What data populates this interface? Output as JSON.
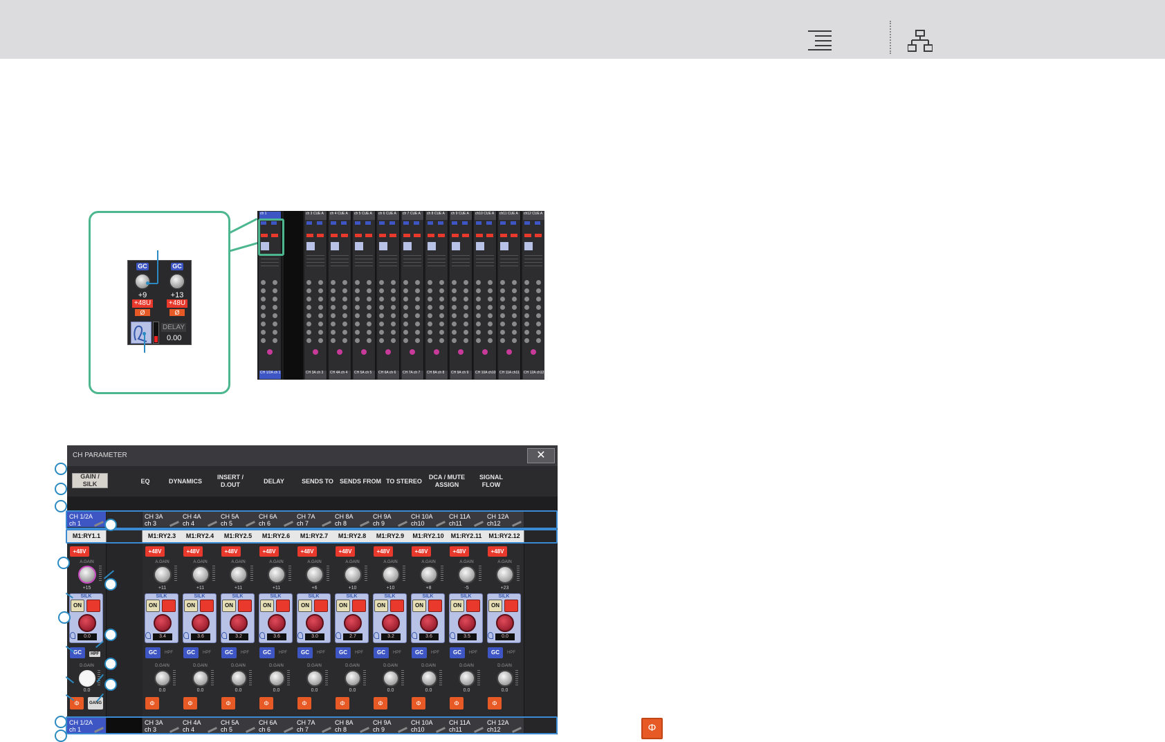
{
  "topbar": {
    "menu_icon": "menu-icon",
    "tree_icon": "hierarchy-icon"
  },
  "zoom": {
    "gc": "GC",
    "left_gain": "+9",
    "right_gain": "+13",
    "p48": "+48U",
    "phase": "Ø",
    "delay_label": "DELAY",
    "delay_value": "0.00"
  },
  "overview": {
    "channels": [
      {
        "h1": "ch 1",
        "h2": "",
        "f1": "CH 1/2A",
        "f2": "ch 1"
      },
      {
        "h1": "ch 3",
        "h2": "CUE A",
        "f1": "CH 3A",
        "f2": "ch 3"
      },
      {
        "h1": "ch 4",
        "h2": "CUE A",
        "f1": "CH 4A",
        "f2": "ch 4"
      },
      {
        "h1": "ch 5",
        "h2": "CUE A",
        "f1": "CH 5A",
        "f2": "ch 5"
      },
      {
        "h1": "ch 6",
        "h2": "CUE A",
        "f1": "CH 6A",
        "f2": "ch 6"
      },
      {
        "h1": "ch 7",
        "h2": "CUE A",
        "f1": "CH 7A",
        "f2": "ch 7"
      },
      {
        "h1": "ch 8",
        "h2": "CUE A",
        "f1": "CH 8A",
        "f2": "ch 8"
      },
      {
        "h1": "ch 9",
        "h2": "CUE A",
        "f1": "CH 9A",
        "f2": "ch 9"
      },
      {
        "h1": "ch10",
        "h2": "CUE A",
        "f1": "CH 10A",
        "f2": "ch10"
      },
      {
        "h1": "ch11",
        "h2": "CUE A",
        "f1": "CH 11A",
        "f2": "ch11"
      },
      {
        "h1": "ch12",
        "h2": "CUE A",
        "f1": "CH 12A",
        "f2": "ch12"
      }
    ]
  },
  "window": {
    "title": "CH PARAMETER",
    "close": "✕",
    "tabs": [
      {
        "label": "GAIN / SILK"
      },
      {
        "label": "EQ"
      },
      {
        "label": "DYNAMICS"
      },
      {
        "label": "INSERT / D.OUT"
      },
      {
        "label": "DELAY"
      },
      {
        "label": "SENDS TO"
      },
      {
        "label": "SENDS FROM"
      },
      {
        "label": "TO STEREO"
      },
      {
        "label": "DCA / MUTE ASSIGN"
      },
      {
        "label": "SIGNAL FLOW"
      }
    ],
    "labels": {
      "p48": "+48V",
      "again": "A.GAIN",
      "silk": "SILK",
      "on": "ON",
      "gc": "GC",
      "hpf": "HPF",
      "dgain": "D.GAIN",
      "phase": "Φ",
      "gang": "GANG"
    },
    "strips": [
      {
        "name1": "CH 1/2A",
        "name2": "ch 1",
        "patch": "M1:RY1.1",
        "again": "+15",
        "silk": "0.0",
        "dgain": "0.0"
      },
      {
        "name1": "CH 3A",
        "name2": "ch 3",
        "patch": "M1:RY2.3",
        "again": "+11",
        "silk": "3.4",
        "dgain": "0.0"
      },
      {
        "name1": "CH 4A",
        "name2": "ch 4",
        "patch": "M1:RY2.4",
        "again": "+11",
        "silk": "3.6",
        "dgain": "0.0"
      },
      {
        "name1": "CH 5A",
        "name2": "ch 5",
        "patch": "M1:RY2.5",
        "again": "+11",
        "silk": "3.2",
        "dgain": "0.0"
      },
      {
        "name1": "CH 6A",
        "name2": "ch 6",
        "patch": "M1:RY2.6",
        "again": "+11",
        "silk": "3.6",
        "dgain": "0.0"
      },
      {
        "name1": "CH 7A",
        "name2": "ch 7",
        "patch": "M1:RY2.7",
        "again": "+6",
        "silk": "3.0",
        "dgain": "0.0"
      },
      {
        "name1": "CH 8A",
        "name2": "ch 8",
        "patch": "M1:RY2.8",
        "again": "+10",
        "silk": "2.7",
        "dgain": "0.0"
      },
      {
        "name1": "CH 9A",
        "name2": "ch 9",
        "patch": "M1:RY2.9",
        "again": "+10",
        "silk": "3.2",
        "dgain": "0.0"
      },
      {
        "name1": "CH 10A",
        "name2": "ch10",
        "patch": "M1:RY2.10",
        "again": "+8",
        "silk": "3.6",
        "dgain": "0.0"
      },
      {
        "name1": "CH 11A",
        "name2": "ch11",
        "patch": "M1:RY2.11",
        "again": "-5",
        "silk": "3.5",
        "dgain": "0.0"
      },
      {
        "name1": "CH 12A",
        "name2": "ch12",
        "patch": "M1:RY2.12",
        "again": "+23",
        "silk": "0.0",
        "dgain": "0.0"
      }
    ]
  },
  "phase_button": "Φ"
}
